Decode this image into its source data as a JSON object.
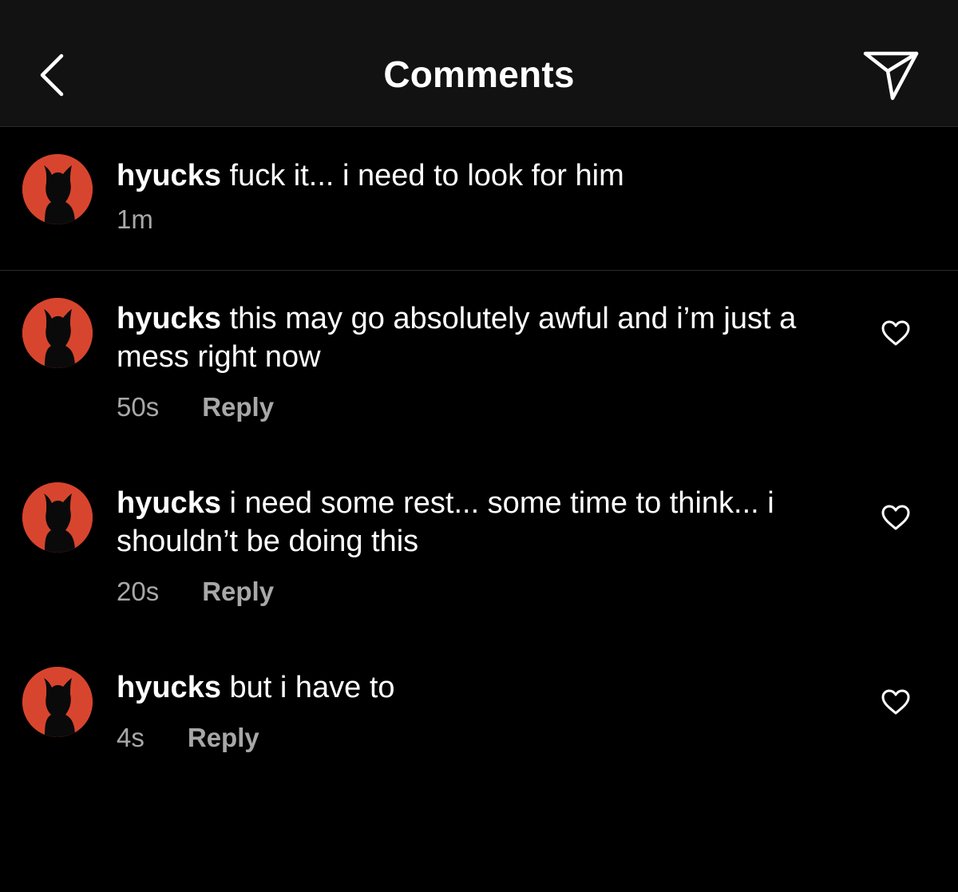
{
  "header": {
    "title": "Comments",
    "back_icon": "chevron-left-icon",
    "share_icon": "paper-plane-icon"
  },
  "caption": {
    "username": "hyucks",
    "text": "fuck it... i need to look for him",
    "time": "1m"
  },
  "comments": [
    {
      "username": "hyucks",
      "text": "this may go absolutely awful and i’m just a mess right now",
      "time": "50s",
      "reply_label": "Reply"
    },
    {
      "username": "hyucks",
      "text": "i need some rest... some time to think... i shouldn’t be doing this",
      "time": "20s",
      "reply_label": "Reply"
    },
    {
      "username": "hyucks",
      "text": "but i have to",
      "time": "4s",
      "reply_label": "Reply"
    }
  ],
  "colors": {
    "background": "#000000",
    "header_background": "#121212",
    "secondary_text": "#a8a8a8",
    "avatar_red": "#d8452e"
  }
}
